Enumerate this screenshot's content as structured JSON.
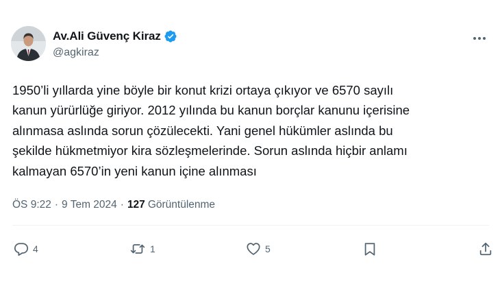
{
  "author": {
    "display_name": "Av.Ali Güvenç Kiraz",
    "handle": "@agkiraz",
    "verified_icon": "verified-badge-icon",
    "avatar_icon": "profile-photo"
  },
  "tweet": {
    "text": "1950’li yıllarda yine böyle bir konut krizi ortaya çıkıyor ve 6570 sayılı\nkanun yürürlüğe giriyor. 2012 yılında bu kanun borçlar kanunu içerisine\nalınmasa aslında sorun çözülecekti. Yani genel hükümler aslında bu\nşekilde hükmetmiyor kira sözleşmelerinde. Sorun aslında hiçbir anlamı\nkalmayan 6570’in yeni kanun içine alınması"
  },
  "meta": {
    "time": "ÖS 9:22",
    "separator": "·",
    "date": "9 Tem 2024",
    "views_count": "127",
    "views_label": "Görüntülenme"
  },
  "actions": {
    "reply_count": "4",
    "repost_count": "1",
    "like_count": "5"
  },
  "colors": {
    "text_primary": "#0f1419",
    "text_secondary": "#536471",
    "verified_blue": "#1d9bf0",
    "divider": "#eff3f4"
  }
}
